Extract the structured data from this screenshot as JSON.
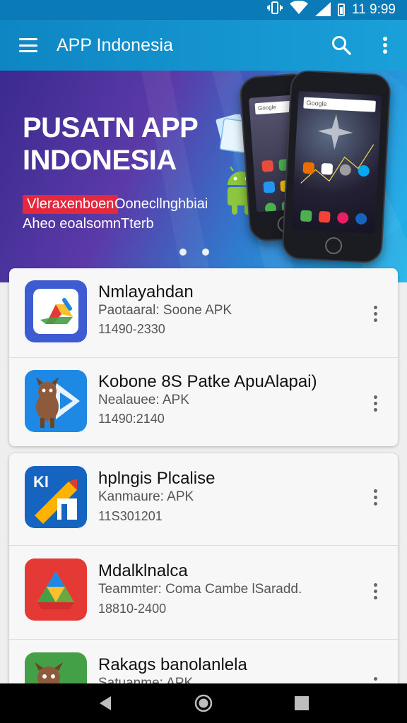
{
  "status_bar": {
    "time": "11 9:99",
    "icons": [
      "vibrate-icon",
      "wifi-icon",
      "signal-icon",
      "battery-icon"
    ]
  },
  "app_bar": {
    "title": "APP Indonesia",
    "icons": [
      "menu-icon",
      "search-icon",
      "more-vert-icon"
    ]
  },
  "banner": {
    "title": "PUSATN APP INDONESIA",
    "tag": "Vleraxenboen",
    "text_line1": "Oonecllnghbiai",
    "text_line2": "Aheo eoalsomnTterb",
    "search_label": "Google",
    "page_count": 2,
    "colors": {
      "tag": "#e5293c"
    }
  },
  "apps": [
    {
      "name": "Nmlayahdan",
      "subtitle": "Paotaaral: Soone APK",
      "meta": "11490-2330",
      "icon": "google-drive-icon"
    },
    {
      "name": "Kobone 8S Patke ApuAlapai)",
      "subtitle": "Nealauee: APK",
      "meta": "11490:2140",
      "icon": "android-mascot-icon"
    },
    {
      "name": "hplngis Plcalise",
      "subtitle": "Kanmaure: APK",
      "meta": "11S301201",
      "icon": "kl-app-icon"
    },
    {
      "name": "Mdalklnalca",
      "subtitle": "Teammter: Coma Cambe lSaradd.",
      "meta": "18810-2400",
      "icon": "google-drive-icon"
    },
    {
      "name": "Rakags banolanlela",
      "subtitle": "Satuanme: APK",
      "meta": "",
      "icon": "android-mascot-icon"
    }
  ],
  "nav_bar": {
    "icons": [
      "back-icon",
      "home-icon",
      "recents-icon"
    ]
  },
  "colors": {
    "app_bar": "#0e86c4",
    "status_bar": "#0b7bb8"
  }
}
